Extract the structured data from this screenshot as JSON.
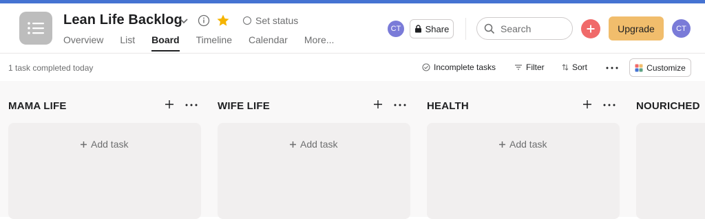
{
  "project": {
    "title": "Lean Life Backlog",
    "set_status_label": "Set status",
    "icon": "list-icon"
  },
  "tabs": [
    {
      "label": "Overview"
    },
    {
      "label": "List"
    },
    {
      "label": "Board",
      "active": true
    },
    {
      "label": "Timeline"
    },
    {
      "label": "Calendar"
    },
    {
      "label": "More..."
    }
  ],
  "header": {
    "avatar_initials": "CT",
    "share_label": "Share",
    "search_placeholder": "Search",
    "upgrade_label": "Upgrade",
    "user_initials": "CT"
  },
  "toolbar": {
    "completed_text": "1 task completed today",
    "incomplete_label": "Incomplete tasks",
    "filter_label": "Filter",
    "sort_label": "Sort",
    "customize_label": "Customize"
  },
  "columns": [
    {
      "title": "MAMA LIFE",
      "add_task_label": "Add task"
    },
    {
      "title": "WIFE LIFE",
      "add_task_label": "Add task"
    },
    {
      "title": "HEALTH",
      "add_task_label": "Add task"
    },
    {
      "title": "NOURICHED"
    }
  ],
  "colors": {
    "accent": "#4573d2",
    "upgrade": "#f1bd6c",
    "add_button": "#f06a6a",
    "avatar": "#7a7bd8",
    "star": "#f5b400"
  }
}
